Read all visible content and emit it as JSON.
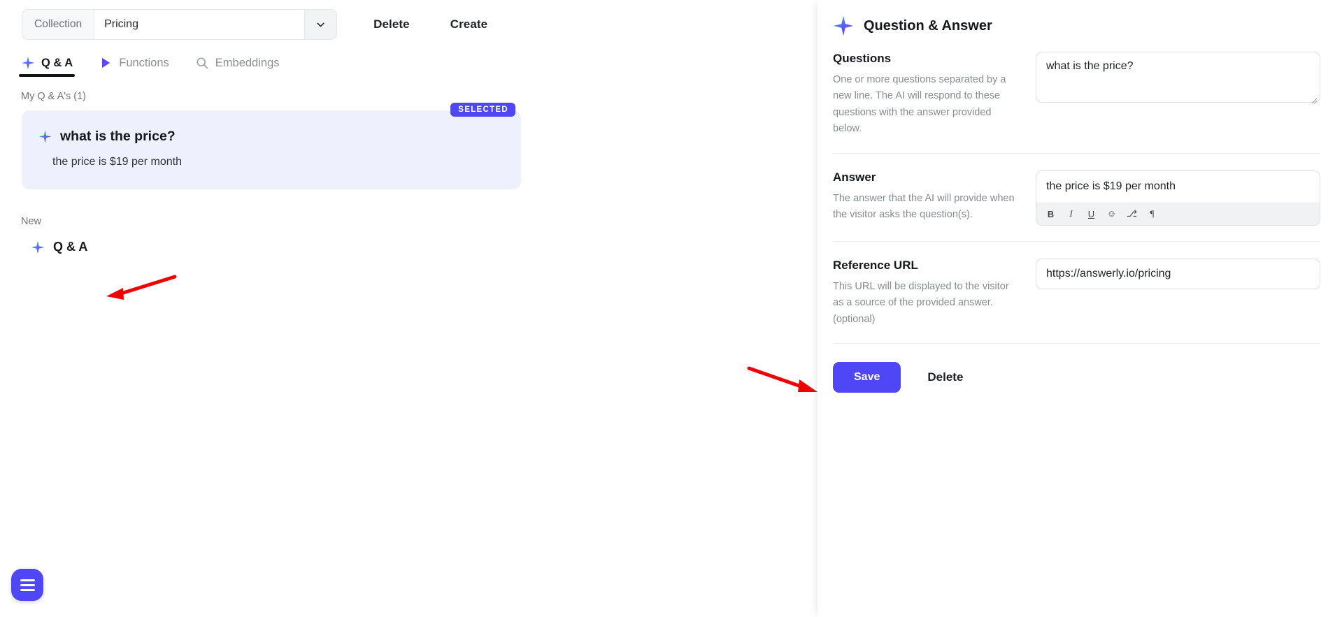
{
  "toolbar": {
    "collection_label": "Collection",
    "collection_value": "Pricing",
    "caret_icon": "chevron-down-icon",
    "delete_label": "Delete",
    "create_label": "Create"
  },
  "tabs": [
    {
      "label": "Q & A",
      "icon": "sparkle-icon",
      "active": true
    },
    {
      "label": "Functions",
      "icon": "play-triangle-icon",
      "active": false
    },
    {
      "label": "Embeddings",
      "icon": "search-icon",
      "active": false
    }
  ],
  "list": {
    "section_label": "My Q & A's (1)",
    "cards": [
      {
        "question": "what is the price?",
        "answer": "the price is $19 per month",
        "badge": "SELECTED",
        "icon": "sparkle-icon"
      }
    ],
    "new_label": "New",
    "new_item": {
      "label": "Q & A",
      "icon": "sparkle-icon"
    }
  },
  "fab": {
    "icon": "hamburger-menu-icon"
  },
  "panel": {
    "title": "Question & Answer",
    "title_icon": "sparkle-icon",
    "sections": [
      {
        "title": "Questions",
        "description": "One or more questions separated by a new line. The AI will respond to these questions with the answer provided below.",
        "value": "what is the price?"
      },
      {
        "title": "Answer",
        "description": "The answer that the AI will provide when the visitor asks the question(s).",
        "value": "the price is $19 per month"
      },
      {
        "title": "Reference URL",
        "description": "This URL will be displayed to the visitor as a source of the provided answer. (optional)",
        "value": "https://answerly.io/pricing"
      }
    ],
    "rte_tools": [
      {
        "label": "B",
        "name": "bold-icon"
      },
      {
        "label": "I",
        "name": "italic-icon"
      },
      {
        "label": "U",
        "name": "underline-icon"
      },
      {
        "label": "☺",
        "name": "emoji-icon"
      },
      {
        "label": "⎇",
        "name": "link-icon"
      },
      {
        "label": "¶",
        "name": "paragraph-icon"
      }
    ],
    "save_label": "Save",
    "delete_label": "Delete"
  },
  "colors": {
    "accent": "#4f46f5",
    "card_bg": "#eef0fd",
    "annotation_arrow": "#f10000",
    "muted_text": "#878c92"
  }
}
